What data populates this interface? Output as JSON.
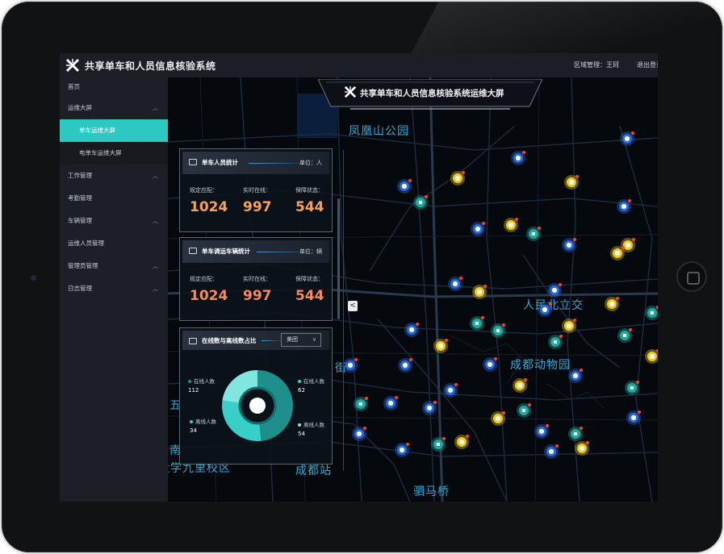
{
  "app": {
    "title": "共享单车和人员信息核验系统",
    "region": "区域管理：王珂",
    "logout": "退出登录"
  },
  "sidebar": {
    "items": [
      {
        "label": "首页",
        "chev": ""
      },
      {
        "label": "运维大屏",
        "chev": "^"
      },
      {
        "label": "单车运维大屏",
        "chev": "",
        "active": true
      },
      {
        "label": "电单车运维大屏",
        "chev": ""
      },
      {
        "label": "工作管理",
        "chev": "^"
      },
      {
        "label": "考勤管理",
        "chev": ""
      },
      {
        "label": "车辆管理",
        "chev": "^"
      },
      {
        "label": "运维人员管理",
        "chev": ""
      },
      {
        "label": "管理员管理",
        "chev": "^"
      },
      {
        "label": "日志管理",
        "chev": "^"
      }
    ]
  },
  "banner": {
    "title": "共享单车和人员信息核验系统运维大屏"
  },
  "panel_people": {
    "title": "单车人员统计",
    "unit": "单位：人",
    "labels": [
      "规定应配：",
      "实时在线：",
      "保障状态："
    ],
    "values": [
      "1024",
      "997",
      "544"
    ]
  },
  "panel_vehicles": {
    "title": "单车调运车辆统计",
    "unit": "单位：辆",
    "labels": [
      "规定应配：",
      "实时在线：",
      "保障状态："
    ],
    "values": [
      "1024",
      "997",
      "544"
    ]
  },
  "panel_ratio": {
    "title": "在线数与离线数占比",
    "select": "美团",
    "legend": [
      {
        "label": "在线人数",
        "value": "112"
      },
      {
        "label": "离线人数",
        "value": "34"
      },
      {
        "label": "在线人数",
        "value": "62"
      },
      {
        "label": "离线人数",
        "value": "54"
      }
    ]
  },
  "map_places": [
    "凤凰山公园",
    "人民北立交",
    "成都动物园",
    "成都站",
    "驷马桥",
    "街",
    "五",
    "南",
    "大学九里校区"
  ],
  "colors": {
    "accent": "#2ec8c3",
    "orange": "#f6a15a",
    "value_red": "#f58a5e"
  }
}
